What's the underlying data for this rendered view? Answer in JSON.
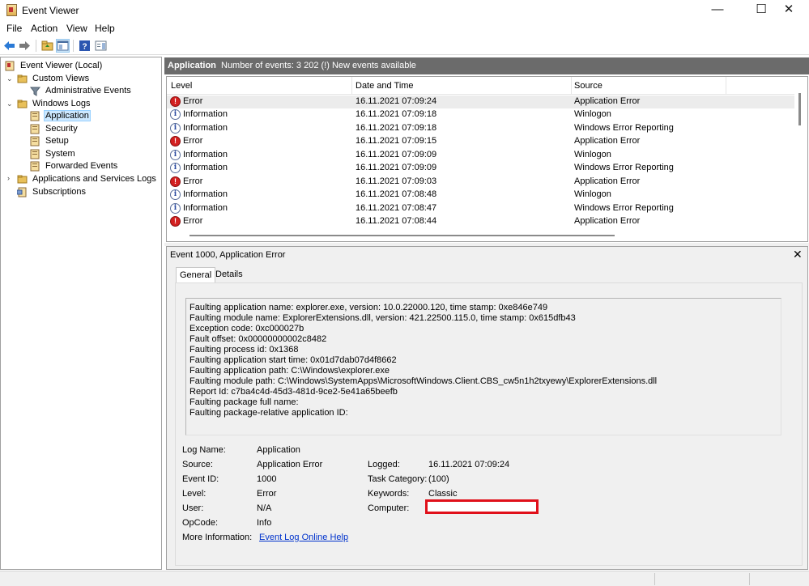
{
  "window": {
    "title": "Event Viewer",
    "minimize": "—",
    "maximize": "☐",
    "close": "✕"
  },
  "menu": [
    "File",
    "Action",
    "View",
    "Help"
  ],
  "tree": {
    "root": "Event Viewer (Local)",
    "custom_views": "Custom Views",
    "administrative_events": "Administrative Events",
    "windows_logs": "Windows Logs",
    "application": "Application",
    "security": "Security",
    "setup": "Setup",
    "system": "System",
    "forwarded_events": "Forwarded Events",
    "apps_services_logs": "Applications and Services Logs",
    "subscriptions": "Subscriptions"
  },
  "header": {
    "log_name": "Application",
    "info": "Number of events: 3 202 (!) New events available"
  },
  "list": {
    "columns": {
      "level": "Level",
      "datetime": "Date and Time",
      "source": "Source"
    },
    "rows": [
      {
        "level": "Error",
        "datetime": "16.11.2021 07:09:24",
        "source": "Application Error"
      },
      {
        "level": "Information",
        "datetime": "16.11.2021 07:09:18",
        "source": "Winlogon"
      },
      {
        "level": "Information",
        "datetime": "16.11.2021 07:09:18",
        "source": "Windows Error Reporting"
      },
      {
        "level": "Error",
        "datetime": "16.11.2021 07:09:15",
        "source": "Application Error"
      },
      {
        "level": "Information",
        "datetime": "16.11.2021 07:09:09",
        "source": "Winlogon"
      },
      {
        "level": "Information",
        "datetime": "16.11.2021 07:09:09",
        "source": "Windows Error Reporting"
      },
      {
        "level": "Error",
        "datetime": "16.11.2021 07:09:03",
        "source": "Application Error"
      },
      {
        "level": "Information",
        "datetime": "16.11.2021 07:08:48",
        "source": "Winlogon"
      },
      {
        "level": "Information",
        "datetime": "16.11.2021 07:08:47",
        "source": "Windows Error Reporting"
      },
      {
        "level": "Error",
        "datetime": "16.11.2021 07:08:44",
        "source": "Application Error"
      }
    ]
  },
  "detail": {
    "title": "Event 1000, Application Error",
    "close": "✕",
    "tabs": {
      "general": "General",
      "details": "Details"
    },
    "description": [
      "Faulting application name: explorer.exe, version: 10.0.22000.120, time stamp: 0xe846e749",
      "Faulting module name: ExplorerExtensions.dll, version: 421.22500.115.0, time stamp: 0x615dfb43",
      "Exception code: 0xc000027b",
      "Fault offset: 0x00000000002c8482",
      "Faulting process id: 0x1368",
      "Faulting application start time: 0x01d7dab07d4f8662",
      "Faulting application path: C:\\Windows\\explorer.exe",
      "Faulting module path: C:\\Windows\\SystemApps\\MicrosoftWindows.Client.CBS_cw5n1h2txyewy\\ExplorerExtensions.dll",
      "Report Id: c7ba4c4d-45d3-481d-9ce2-5e41a65beefb",
      "Faulting package full name:",
      "Faulting package-relative application ID:"
    ],
    "props": {
      "log_name_label": "Log Name:",
      "log_name": "Application",
      "source_label": "Source:",
      "source": "Application Error",
      "event_id_label": "Event ID:",
      "event_id": "1000",
      "level_label": "Level:",
      "level": "Error",
      "user_label": "User:",
      "user": "N/A",
      "opcode_label": "OpCode:",
      "opcode": "Info",
      "more_info_label": "More Information:",
      "more_info_link": "Event Log Online Help",
      "logged_label": "Logged:",
      "logged": "16.11.2021 07:09:24",
      "task_category_label": "Task Category:",
      "task_category": "(100)",
      "keywords_label": "Keywords:",
      "keywords": "Classic",
      "computer_label": "Computer:"
    }
  },
  "icons": {
    "error_glyph": "!",
    "info_glyph": "i",
    "chevron_down": "⌄",
    "chevron_right": "›"
  },
  "colors": {
    "accent_highlight": "#e0101a",
    "header_bar": "#6b6b6b",
    "selection": "#cce8ff"
  }
}
